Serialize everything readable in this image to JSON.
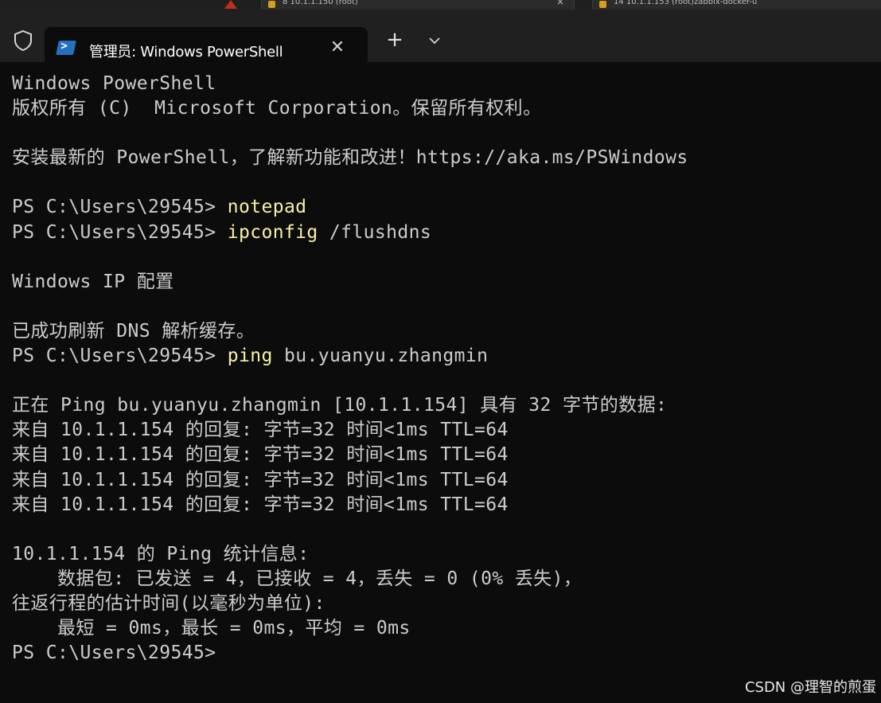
{
  "background_tabs": [
    {
      "label": "8  10.1.1.150 (root)",
      "close": "×"
    },
    {
      "label": "14  10.1.1.153 (root)zabbix-docker-u",
      "close": "×"
    }
  ],
  "window": {
    "tab_title": "管理员: Windows PowerShell",
    "tab_close": "✕",
    "new_tab": "+",
    "dropdown": "⌄",
    "icons": {
      "shield": "shield-icon",
      "powershell": "powershell-icon",
      "warning": "warning-icon"
    }
  },
  "terminal": {
    "prompt_color": "#cccccc",
    "command_color": "#f9f1a5",
    "lines": [
      {
        "text": "Windows PowerShell"
      },
      {
        "text": "版权所有 (C)  Microsoft Corporation。保留所有权利。"
      },
      {
        "text": ""
      },
      {
        "text": "安装最新的 PowerShell，了解新功能和改进！https://aka.ms/PSWindows"
      },
      {
        "text": ""
      },
      {
        "prompt": "PS C:\\Users\\29545> ",
        "cmd": "notepad",
        "args": ""
      },
      {
        "prompt": "PS C:\\Users\\29545> ",
        "cmd": "ipconfig",
        "args": " /flushdns"
      },
      {
        "text": ""
      },
      {
        "text": "Windows IP 配置"
      },
      {
        "text": ""
      },
      {
        "text": "已成功刷新 DNS 解析缓存。"
      },
      {
        "prompt": "PS C:\\Users\\29545> ",
        "cmd": "ping",
        "args": " bu.yuanyu.zhangmin"
      },
      {
        "text": ""
      },
      {
        "text": "正在 Ping bu.yuanyu.zhangmin [10.1.1.154] 具有 32 字节的数据:"
      },
      {
        "text": "来自 10.1.1.154 的回复: 字节=32 时间<1ms TTL=64"
      },
      {
        "text": "来自 10.1.1.154 的回复: 字节=32 时间<1ms TTL=64"
      },
      {
        "text": "来自 10.1.1.154 的回复: 字节=32 时间<1ms TTL=64"
      },
      {
        "text": "来自 10.1.1.154 的回复: 字节=32 时间<1ms TTL=64"
      },
      {
        "text": ""
      },
      {
        "text": "10.1.1.154 的 Ping 统计信息:"
      },
      {
        "text": "    数据包: 已发送 = 4，已接收 = 4，丢失 = 0 (0% 丢失)，"
      },
      {
        "text": "往返行程的估计时间(以毫秒为单位):"
      },
      {
        "text": "    最短 = 0ms，最长 = 0ms，平均 = 0ms"
      },
      {
        "prompt": "PS C:\\Users\\29545> ",
        "cmd": "",
        "args": ""
      }
    ]
  },
  "watermark": "CSDN @理智的煎蛋"
}
